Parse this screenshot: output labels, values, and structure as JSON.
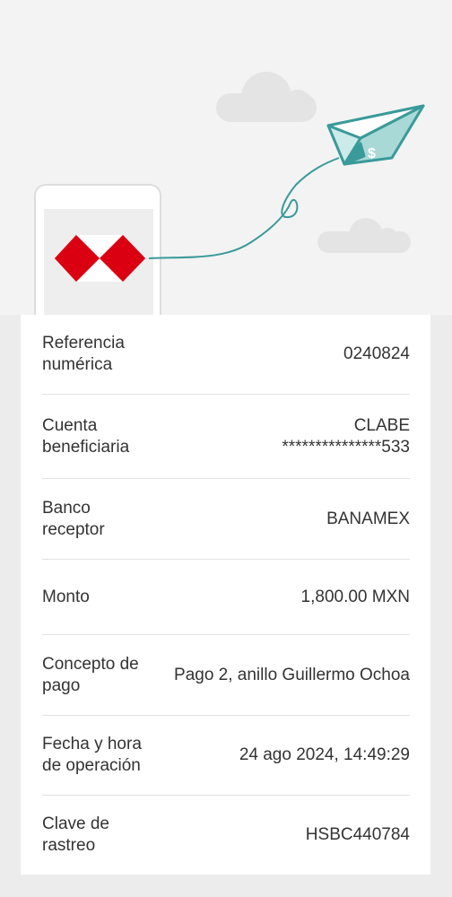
{
  "colors": {
    "brand_red": "#db0011",
    "plane_teal": "#3a9a9a",
    "cloud_gray": "#e6e6e6"
  },
  "hero": {
    "icons": [
      "cloud-icon",
      "paper-plane-icon",
      "phone-icon",
      "hsbc-logo"
    ]
  },
  "rows": [
    {
      "label": "Referencia numérica",
      "value": [
        "0240824"
      ]
    },
    {
      "label": "Cuenta beneficiaria",
      "value": [
        "CLABE",
        "***************533"
      ]
    },
    {
      "label": "Banco receptor",
      "value": [
        "BANAMEX"
      ]
    },
    {
      "label": "Monto",
      "value": [
        "1,800.00 MXN"
      ]
    },
    {
      "label": "Concepto de pago",
      "value": [
        "Pago 2, anillo Guillermo Ochoa"
      ]
    },
    {
      "label": "Fecha y hora de operación",
      "value": [
        "24 ago 2024, 14:49:29"
      ]
    },
    {
      "label": "Clave de rastreo",
      "value": [
        "HSBC440784"
      ]
    }
  ]
}
